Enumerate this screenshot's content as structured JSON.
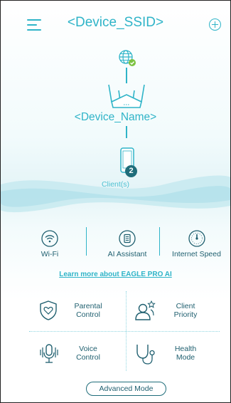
{
  "header": {
    "ssid": "<Device_SSID>"
  },
  "topology": {
    "device_name": "<Device_Name>",
    "client_count": "2",
    "clients_label": "Client(s)"
  },
  "features": [
    {
      "label": "Wi-Fi",
      "icon": "wifi-icon"
    },
    {
      "label": "AI Assistant",
      "icon": "document-icon"
    },
    {
      "label": "Internet Speed",
      "icon": "speedometer-icon"
    }
  ],
  "learn_more": "Learn more about EAGLE PRO AI",
  "tiles": {
    "parental_control": {
      "line1": "Parental",
      "line2": "Control",
      "icon": "shield-heart-icon"
    },
    "client_priority": {
      "line1": "Client",
      "line2": "Priority",
      "icon": "users-star-icon"
    },
    "voice_control": {
      "line1": "Voice",
      "line2": "Control",
      "icon": "microphone-icon"
    },
    "health_mode": {
      "line1": "Health",
      "line2": "Mode",
      "icon": "stethoscope-icon"
    }
  },
  "advanced_mode": "Advanced Mode",
  "colors": {
    "accent": "#2fb4c8",
    "text_dark": "#1f5f6f",
    "badge": "#1f6d7a",
    "status_ok": "#7cc242"
  }
}
